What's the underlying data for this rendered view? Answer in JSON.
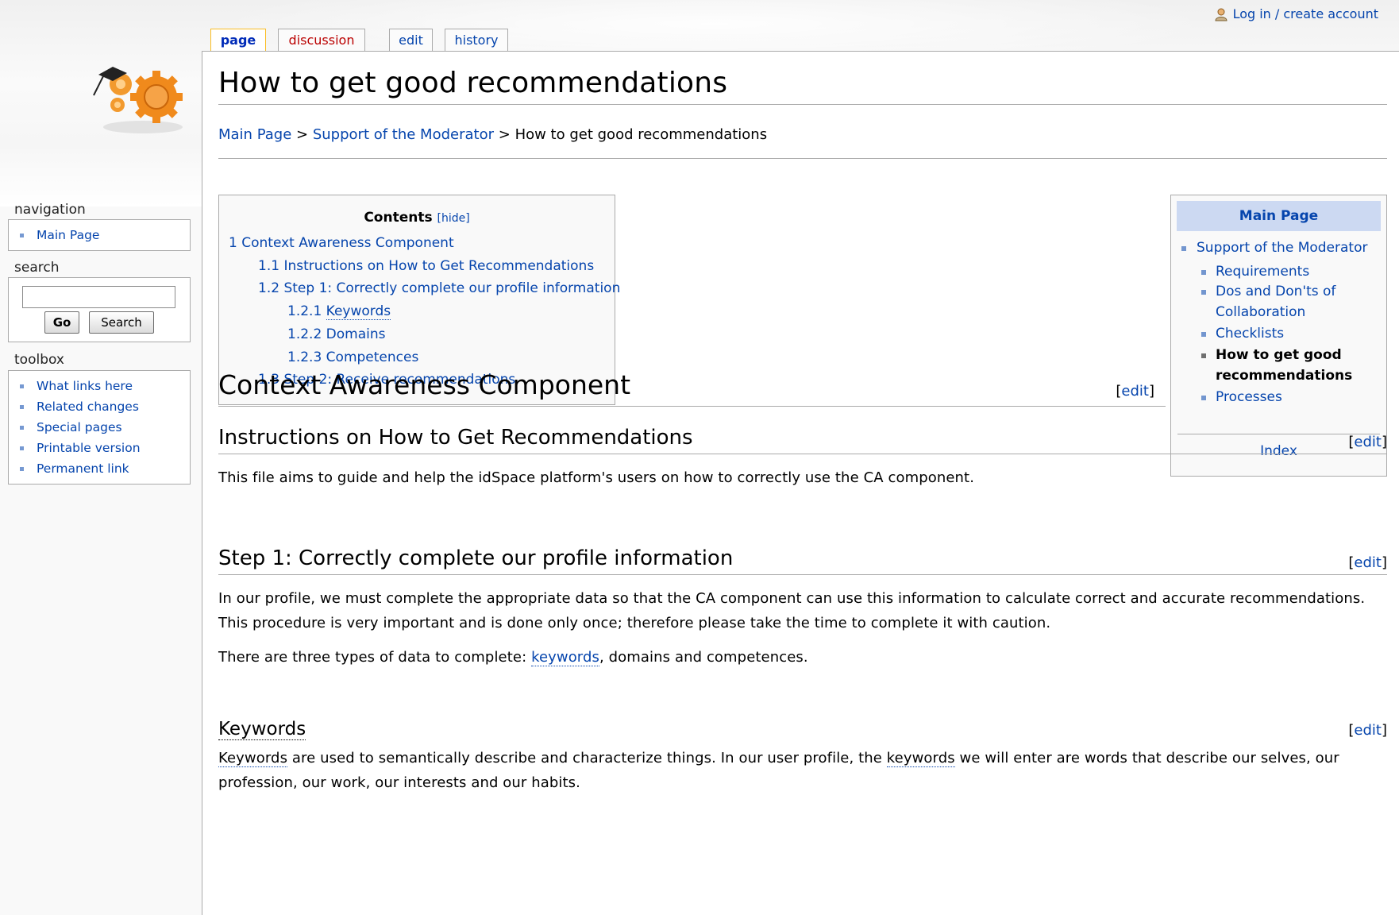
{
  "header": {
    "login_text": "Log in / create account"
  },
  "tabs": [
    {
      "label": "page"
    },
    {
      "label": "discussion"
    },
    {
      "label": "edit"
    },
    {
      "label": "history"
    }
  ],
  "page": {
    "title": "How to get good recommendations",
    "breadcrumb": {
      "items": [
        "Main Page",
        "Support of the Moderator"
      ],
      "separator": ">",
      "current": "How to get good recommendations"
    }
  },
  "toc": {
    "title": "Contents",
    "hide_label": "[hide]",
    "entries": [
      {
        "num": "1",
        "text": "Context Awareness Component"
      },
      {
        "num": "1.1",
        "text": "Instructions on How to Get Recommendations"
      },
      {
        "num": "1.2",
        "text": "Step 1: Correctly complete our profile information"
      },
      {
        "num": "1.2.1",
        "text": "Keywords"
      },
      {
        "num": "1.2.2",
        "text": "Domains"
      },
      {
        "num": "1.2.3",
        "text": "Competences"
      },
      {
        "num": "1.3",
        "text": "Step 2: Receive recommendations"
      }
    ]
  },
  "navbox": {
    "title": "Main Page",
    "parent": "Support of the Moderator",
    "children": [
      "Requirements",
      "Dos and Don'ts of Collaboration",
      "Checklists",
      "How to get good recommendations",
      "Processes"
    ],
    "footer": "Index"
  },
  "sections": {
    "edit_open": "[",
    "edit_label": "edit",
    "edit_close": "]",
    "h2": "Context Awareness Component",
    "instructions_heading": "Instructions on How to Get Recommendations",
    "instructions_text": "This file aims to guide and help the idSpace platform's users on how to correctly use the CA component.",
    "step1_heading": "Step 1: Correctly complete our profile information",
    "step1_text": "In our profile, we must complete the appropriate data so that the CA component can use this information to calculate correct and accurate recommendations. This procedure is very important and is done only once; therefore please take the time to complete it with caution.",
    "types_text_before": "There are three types of data to complete: ",
    "types_link": "keywords",
    "types_text_after": ", domains and competences.",
    "keywords_heading": "Keywords",
    "keywords_link1": "Keywords",
    "keywords_text1": " are used to semantically describe and characterize things. In our user profile, the ",
    "keywords_link2": "keywords",
    "keywords_text2": " we will enter are words that describe our selves, our profession, our work, our interests and our habits."
  },
  "sidebar": {
    "navigation_heading": "navigation",
    "navigation_items": [
      "Main Page"
    ],
    "search_heading": "search",
    "go_label": "Go",
    "search_label": "Search",
    "toolbox_heading": "toolbox",
    "toolbox_items": [
      "What links here",
      "Related changes",
      "Special pages",
      "Printable version",
      "Permanent link"
    ]
  },
  "colors": {
    "link": "#0645ad",
    "redlink": "#ba0000",
    "navbox_title_bg": "#ccd9f2",
    "selected_tab_border": "#fabd23"
  }
}
